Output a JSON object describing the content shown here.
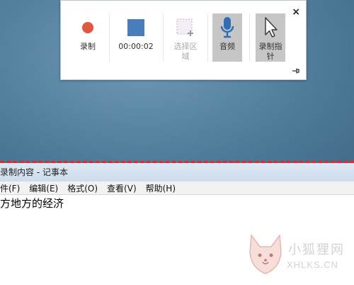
{
  "toolbar": {
    "record_label": "录制",
    "time_display": "00:00:02",
    "select_area_label_line1": "选择区",
    "select_area_label_line2": "域",
    "audio_label": "音频",
    "pointer_label_line1": "录制指",
    "pointer_label_line2": "针",
    "close_symbol": "×"
  },
  "notepad": {
    "title": "录制内容 - 记事本",
    "menu": [
      "件(F)",
      "编辑(E)",
      "格式(O)",
      "查看(V)",
      "帮助(H)"
    ],
    "content": "方地方的经济"
  },
  "watermark": {
    "text_cn": "小狐狸网",
    "text_en": "XHLKS.CN"
  },
  "colors": {
    "record_red": "#e2563f",
    "stop_blue": "#4a7ebb",
    "dash_red": "#e8262b"
  }
}
